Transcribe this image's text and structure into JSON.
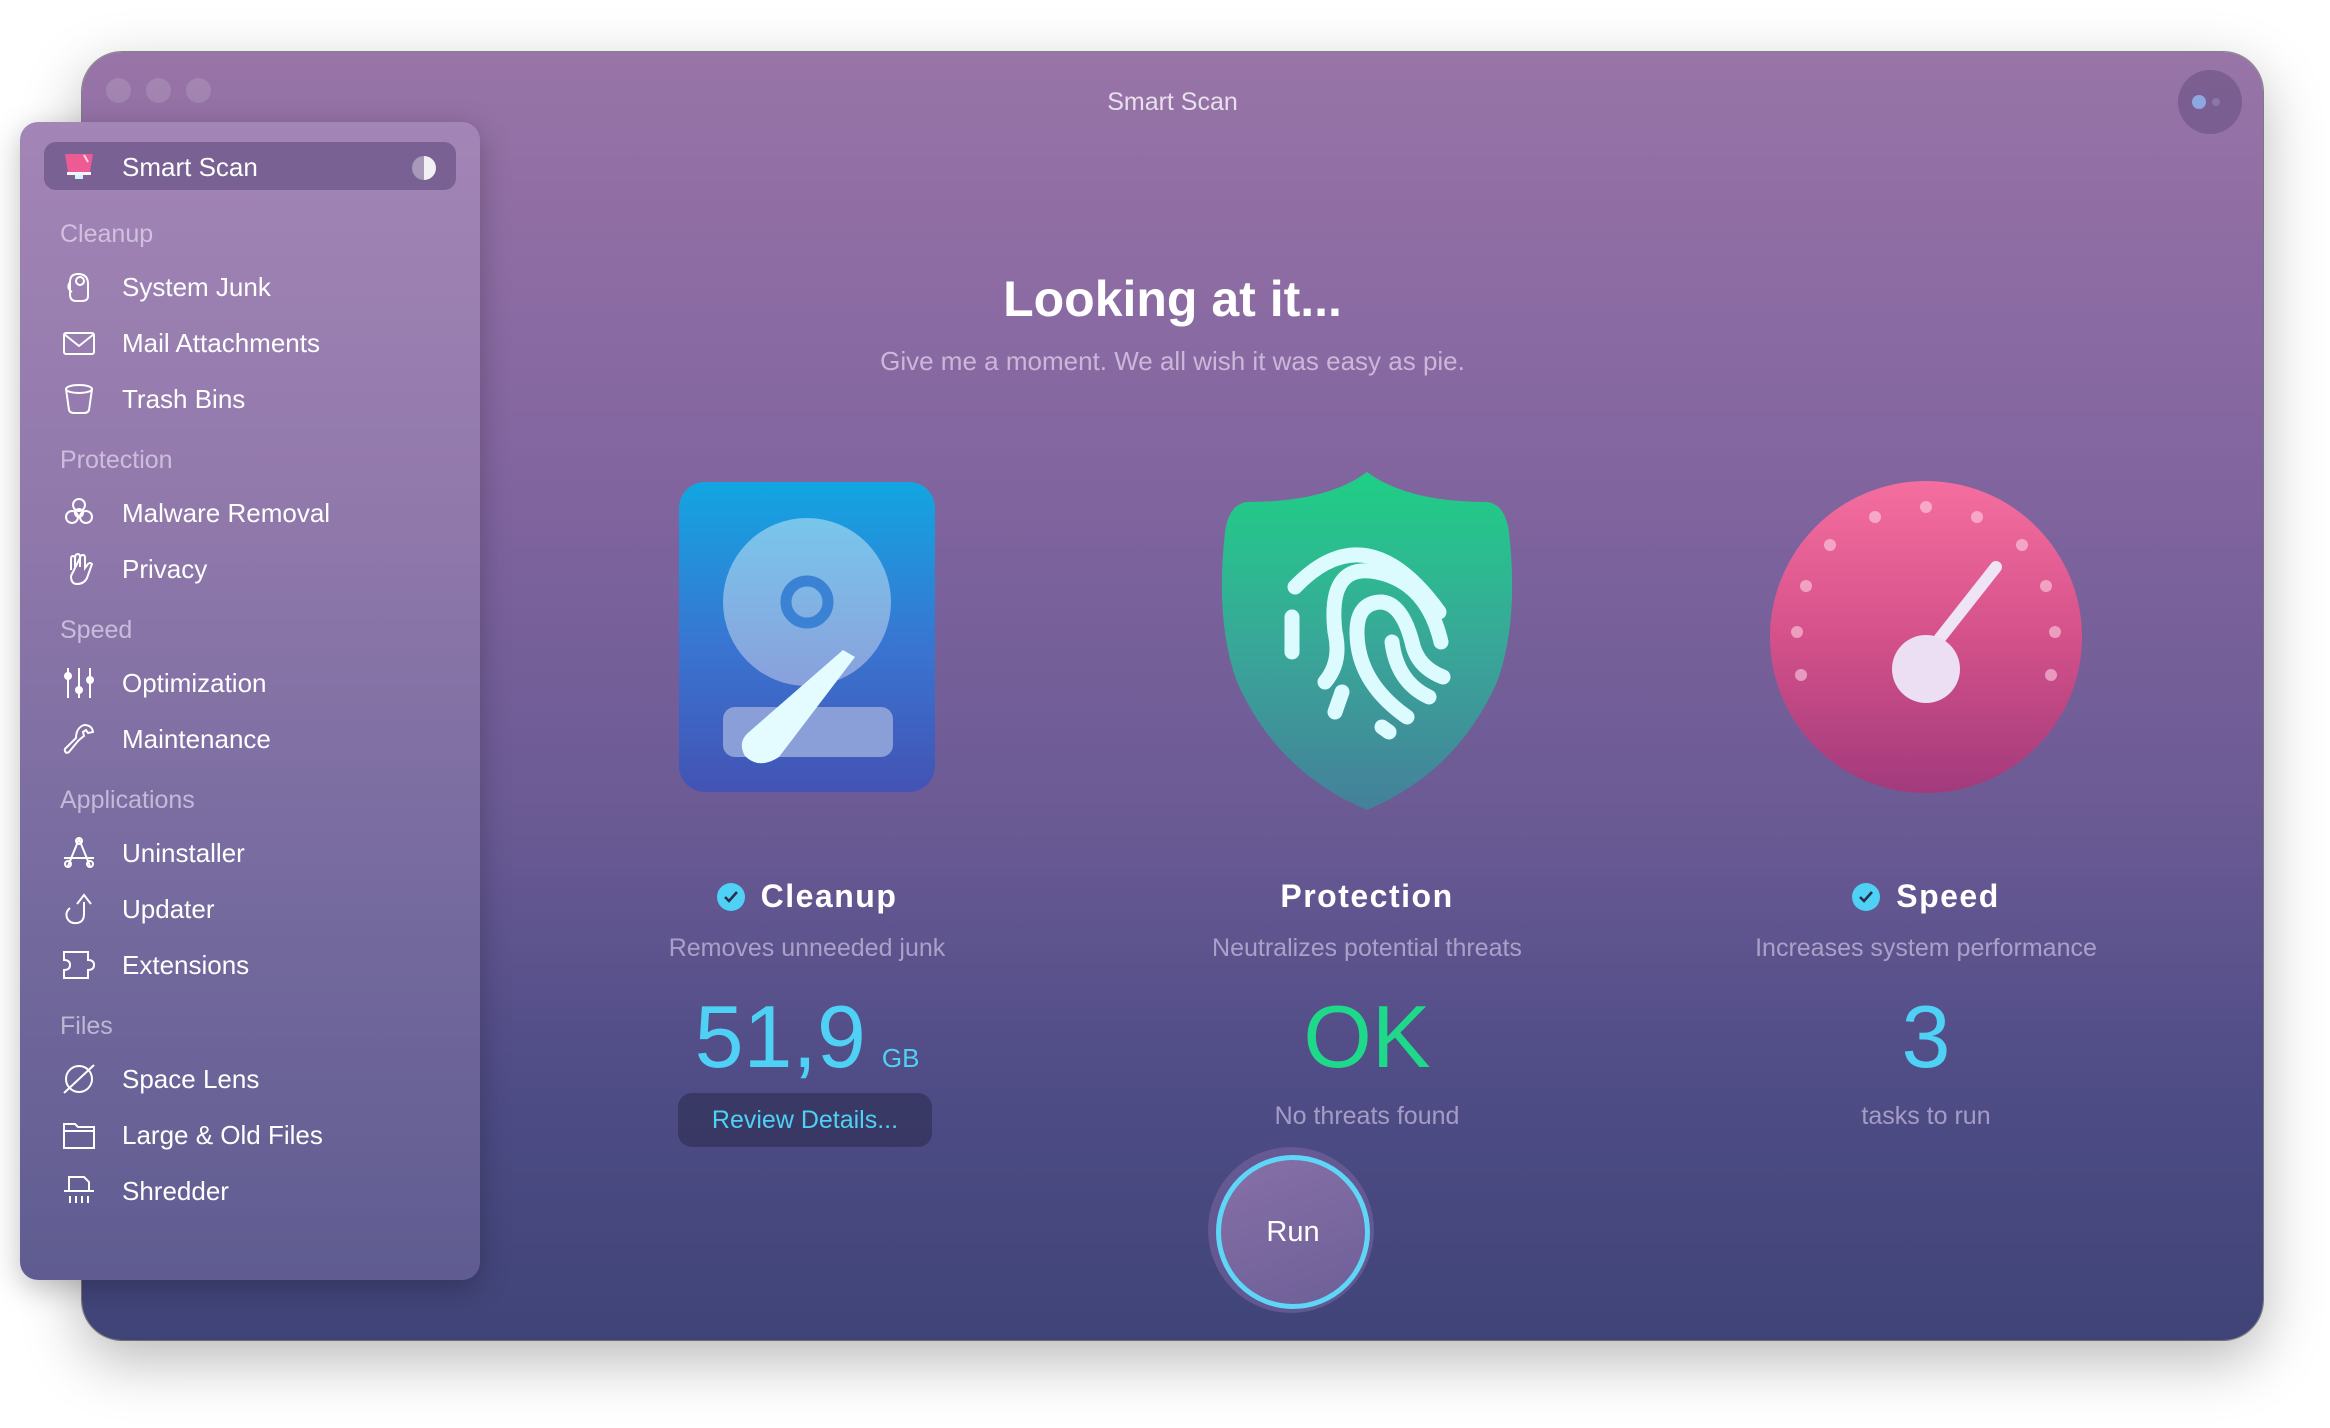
{
  "window": {
    "title": "Smart Scan"
  },
  "main": {
    "headline": "Looking at it...",
    "subhead": "Give me a moment. We all wish it was easy as pie.",
    "columns": [
      {
        "title": "Cleanup",
        "checked": true,
        "description": "Removes unneeded junk",
        "value": "51,9",
        "unit": "GB",
        "value_color": "#4fd1f5",
        "action_label": "Review Details..."
      },
      {
        "title": "Protection",
        "checked": false,
        "description": "Neutralizes potential threats",
        "value": "OK",
        "value_color": "#1fd98a",
        "subtext": "No threats found"
      },
      {
        "title": "Speed",
        "checked": true,
        "description": "Increases system performance",
        "value": "3",
        "value_color": "#4fd1f5",
        "subtext": "tasks to run"
      }
    ],
    "run_label": "Run"
  },
  "sidebar": {
    "selected": {
      "label": "Smart Scan",
      "icon": "monitor-icon"
    },
    "sections": [
      {
        "label": "Cleanup",
        "items": [
          {
            "label": "System Junk",
            "icon": "system-junk-icon"
          },
          {
            "label": "Mail Attachments",
            "icon": "mail-icon"
          },
          {
            "label": "Trash Bins",
            "icon": "trash-icon"
          }
        ]
      },
      {
        "label": "Protection",
        "items": [
          {
            "label": "Malware Removal",
            "icon": "biohazard-icon"
          },
          {
            "label": "Privacy",
            "icon": "hand-icon"
          }
        ]
      },
      {
        "label": "Speed",
        "items": [
          {
            "label": "Optimization",
            "icon": "sliders-icon"
          },
          {
            "label": "Maintenance",
            "icon": "wrench-icon"
          }
        ]
      },
      {
        "label": "Applications",
        "items": [
          {
            "label": "Uninstaller",
            "icon": "app-store-icon"
          },
          {
            "label": "Updater",
            "icon": "update-arrow-icon"
          },
          {
            "label": "Extensions",
            "icon": "puzzle-icon"
          }
        ]
      },
      {
        "label": "Files",
        "items": [
          {
            "label": "Space Lens",
            "icon": "planet-icon"
          },
          {
            "label": "Large & Old Files",
            "icon": "folder-icon"
          },
          {
            "label": "Shredder",
            "icon": "shredder-icon"
          }
        ]
      }
    ]
  },
  "colors": {
    "accent": "#4fd1f5",
    "ok": "#1fd98a",
    "window_top": "#9874a7",
    "window_bottom": "#3f4477"
  }
}
